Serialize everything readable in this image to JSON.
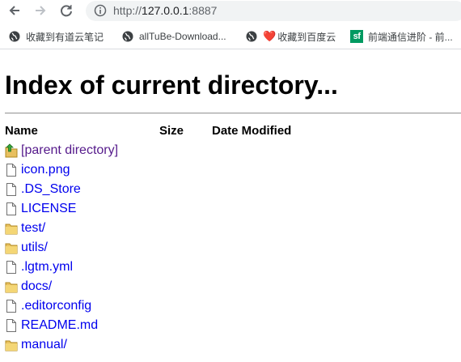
{
  "browser": {
    "back_icon": "arrow-left-icon",
    "forward_icon": "arrow-right-icon",
    "reload_icon": "reload-icon",
    "url_scheme": "http://",
    "url_host": "127.0.0.1",
    "url_port": ":8887"
  },
  "bookmarks": [
    {
      "label": "收藏到有道云笔记",
      "icon": "globe-icon"
    },
    {
      "label": "allTuBe-Download...",
      "icon": "globe-icon"
    },
    {
      "label": "收藏到百度云",
      "icon": "globe-icon",
      "prefix": "❤️"
    },
    {
      "label": "前端通信进阶 - 前...",
      "icon": "sf-icon",
      "icon_text": "sf"
    }
  ],
  "page": {
    "title": "Index of current directory...",
    "columns": {
      "name": "Name",
      "size": "Size",
      "modified": "Date Modified"
    },
    "entries": [
      {
        "name": "[parent directory]",
        "type": "parent"
      },
      {
        "name": "icon.png",
        "type": "file"
      },
      {
        "name": ".DS_Store",
        "type": "file"
      },
      {
        "name": "LICENSE",
        "type": "file"
      },
      {
        "name": "test/",
        "type": "folder"
      },
      {
        "name": "utils/",
        "type": "folder"
      },
      {
        "name": ".lgtm.yml",
        "type": "file"
      },
      {
        "name": "docs/",
        "type": "folder"
      },
      {
        "name": ".editorconfig",
        "type": "file"
      },
      {
        "name": "README.md",
        "type": "file"
      },
      {
        "name": "manual/",
        "type": "folder"
      }
    ]
  }
}
